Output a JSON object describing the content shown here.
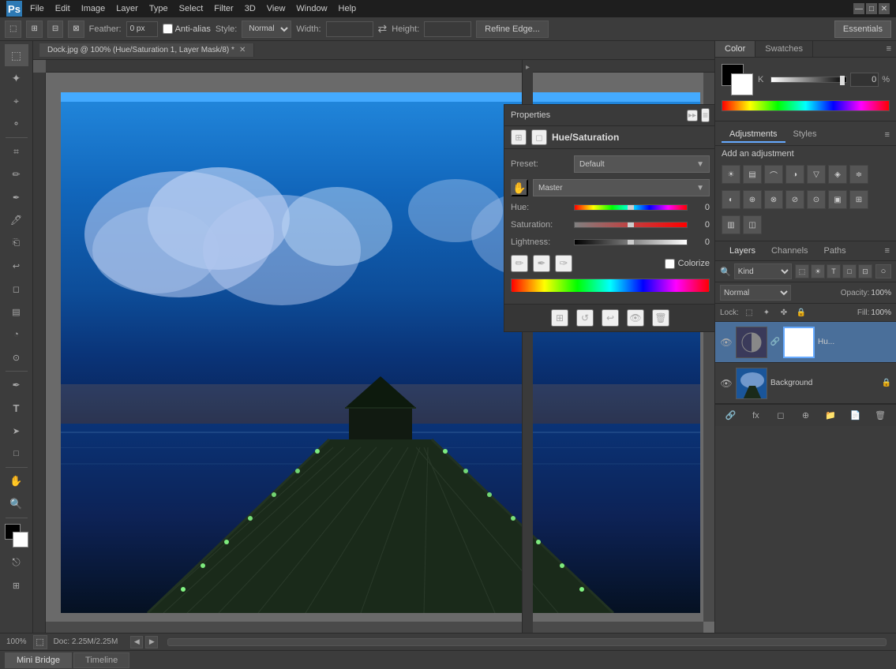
{
  "titlebar": {
    "app_name": "Ps",
    "menus": [
      "File",
      "Edit",
      "Image",
      "Layer",
      "Type",
      "Select",
      "Filter",
      "3D",
      "View",
      "Window",
      "Help"
    ],
    "win_buttons": [
      "—",
      "□",
      "✕"
    ]
  },
  "options_bar": {
    "feather_label": "Feather:",
    "feather_value": "0 px",
    "anti_alias_label": "Anti-alias",
    "style_label": "Style:",
    "style_value": "Normal",
    "width_label": "Width:",
    "height_label": "Height:",
    "refine_edge_btn": "Refine Edge...",
    "essentials_btn": "Essentials"
  },
  "canvas_tab": {
    "title": "Dock.jpg @ 100% (Hue/Saturation 1, Layer Mask/8) *",
    "close": "✕"
  },
  "properties_panel": {
    "title": "Properties",
    "panel_title": "Hue/Saturation",
    "preset_label": "Preset:",
    "preset_value": "Default",
    "channel_value": "Master",
    "hue_label": "Hue:",
    "hue_value": "0",
    "saturation_label": "Saturation:",
    "saturation_value": "0",
    "lightness_label": "Lightness:",
    "lightness_value": "0",
    "colorize_label": "Colorize",
    "footer_buttons": [
      "⊞",
      "↺",
      "↩",
      "👁",
      "🗑"
    ]
  },
  "color_panel": {
    "tab_color": "Color",
    "tab_swatches": "Swatches",
    "k_label": "K",
    "k_value": "0",
    "percent": "%"
  },
  "adjustments_panel": {
    "tab_adjustments": "Adjustments",
    "tab_styles": "Styles",
    "add_adjustment": "Add an adjustment"
  },
  "layers_panel": {
    "tab_layers": "Layers",
    "tab_channels": "Channels",
    "tab_paths": "Paths",
    "kind_label": "Kind",
    "blend_mode": "Normal",
    "opacity_label": "Opacity:",
    "opacity_value": "100%",
    "lock_label": "Lock:",
    "fill_label": "Fill:",
    "fill_value": "100%",
    "layers": [
      {
        "name": "Hu...",
        "type": "adjustment",
        "visible": true
      },
      {
        "name": "Background",
        "type": "image",
        "visible": true,
        "locked": true
      }
    ]
  },
  "status_bar": {
    "zoom": "100%",
    "doc_info": "Doc: 2.25M/2.25M"
  },
  "bottom_tabs": {
    "mini_bridge": "Mini Bridge",
    "timeline": "Timeline"
  },
  "tools": {
    "list": [
      "⬚",
      "◻",
      "◻",
      "◻",
      "⌖",
      "✦",
      "✏",
      "✒",
      "🪣",
      "⌗",
      "✂",
      "⊕",
      "✋",
      "✤",
      "⚲",
      "🖊",
      "🔲",
      "⌨",
      "➤",
      "✋",
      "🔍",
      "⎋"
    ]
  }
}
